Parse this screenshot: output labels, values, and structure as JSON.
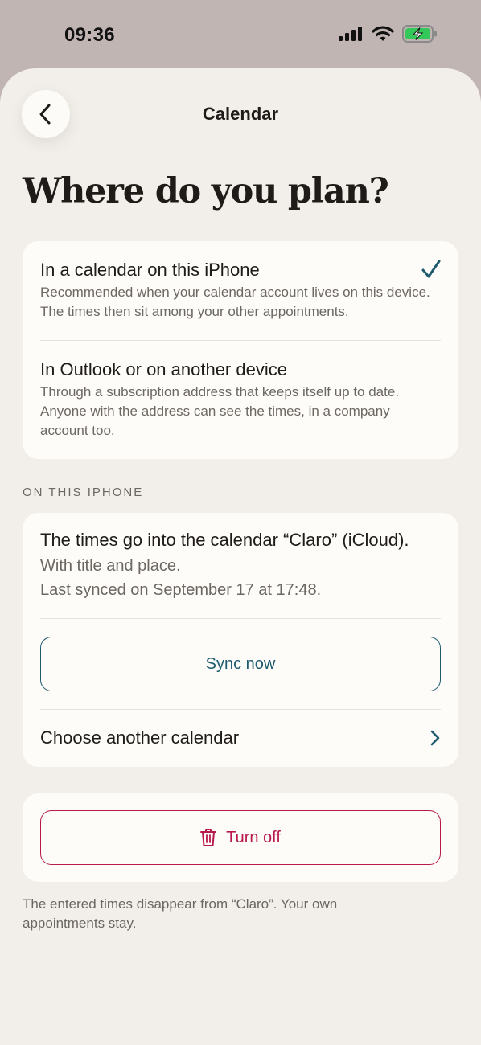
{
  "status_bar": {
    "time": "09:36",
    "icons": [
      "signal-icon",
      "wifi-icon",
      "battery-charging-icon"
    ]
  },
  "nav": {
    "title": "Calendar",
    "back_icon": "chevron-left-icon"
  },
  "page": {
    "title": "Where do you plan?"
  },
  "options": [
    {
      "title": "In a calendar on this iPhone",
      "description": "Recommended when your calendar account lives on this device. The times then sit among your other appointments.",
      "selected": true
    },
    {
      "title": "In Outlook or on another device",
      "description": "Through a subscription address that keeps itself up to date. Anyone with the address can see the times, in a company account too.",
      "selected": false
    }
  ],
  "section": {
    "label": "ON THIS IPHONE"
  },
  "sync_card": {
    "title": "The times go into the calendar “Claro” (iCloud).",
    "detail": "With title and place.",
    "last_synced": "Last synced on September 17 at 17:48.",
    "sync_button": "Sync now",
    "choose_label": "Choose another calendar"
  },
  "turn_off": {
    "button": "Turn off",
    "icon": "trash-icon",
    "footnote": "The entered times disappear from “Claro”. Your own appointments stay."
  },
  "colors": {
    "accent_teal": "#1e5a6e",
    "destructive": "#b8184e",
    "battery_green": "#34c759"
  }
}
